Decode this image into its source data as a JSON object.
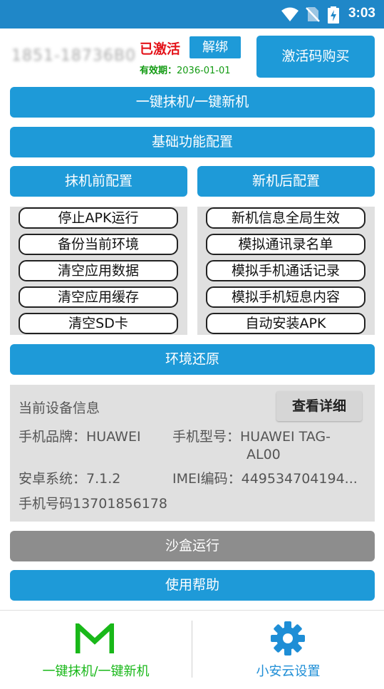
{
  "status_bar": {
    "time": "3:03"
  },
  "account": {
    "phone_masked": "1851-18736B0",
    "status": "已激活",
    "unbind_label": "解绑",
    "validity_label": "有效期：",
    "validity_date": "2036-01-01",
    "buy_label": "激活码购买"
  },
  "main_buttons": {
    "one_click": "一键抹机/一键新机",
    "basic_config": "基础功能配置",
    "pre_wipe": "抹机前配置",
    "post_new": "新机后配置",
    "restore": "环境还原",
    "sandbox": "沙盒运行",
    "help": "使用帮助"
  },
  "pre_wipe_options": [
    "停止APK运行",
    "备份当前环境",
    "清空应用数据",
    "清空应用缓存",
    "清空SD卡"
  ],
  "post_new_options": [
    "新机信息全局生效",
    "模拟通讯录名单",
    "模拟手机通话记录",
    "模拟手机短息内容",
    "自动安装APK"
  ],
  "device_info": {
    "title": "当前设备信息",
    "detail_button": "查看详细",
    "brand": "手机品牌：HUAWEI",
    "model_line1": "手机型号：HUAWEI TAG-",
    "model_line2": "AL00",
    "android": "安卓系统：7.1.2",
    "imei": "IMEI编码：449534704194...",
    "phone": "手机号码13701856178"
  },
  "bottom_nav": {
    "left_label": "一键抹机/一键新机",
    "left_icon": "m-logo-icon",
    "left_color": "#19b819",
    "right_label": "小安云设置",
    "right_icon": "gear-icon",
    "right_color": "#1e8ed6"
  },
  "colors": {
    "primary": "#1e9ad8",
    "status_bar": "#1f87c8",
    "active_red": "#e4141b",
    "validity_green": "#139b13",
    "sandbox_gray": "#8d8d8d"
  }
}
